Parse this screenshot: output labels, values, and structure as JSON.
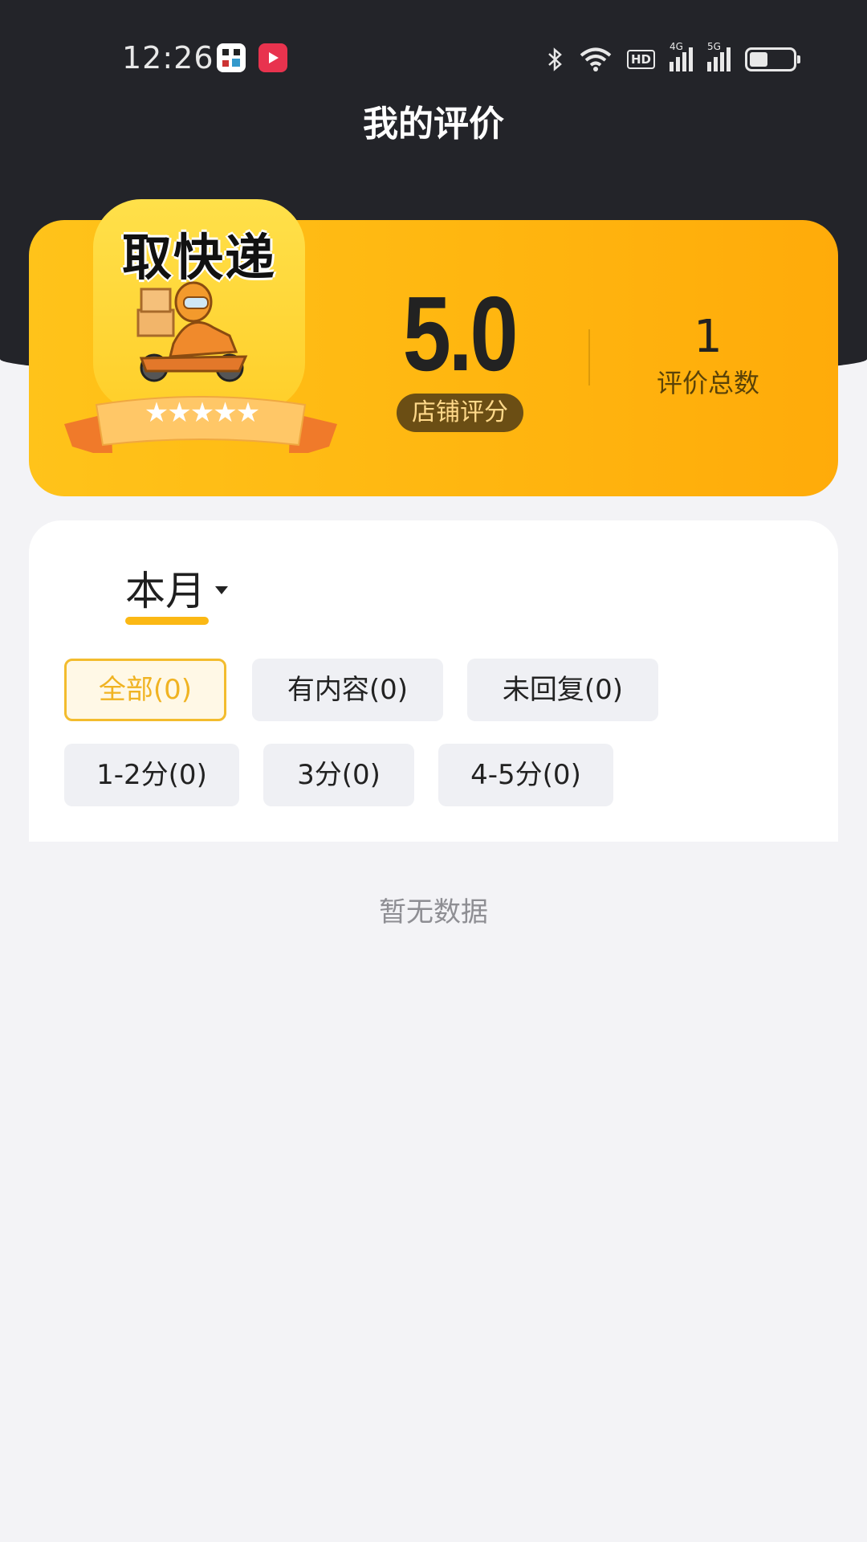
{
  "status_bar": {
    "time": "12:26",
    "signal_1_label": "4G",
    "signal_2_label": "5G",
    "hd_label": "HD"
  },
  "header": {
    "title": "我的评价"
  },
  "score_card": {
    "logo_text": "取快递",
    "stars": "★★★★★",
    "score": "5.0",
    "score_label": "店铺评分",
    "total": "1",
    "total_label": "评价总数"
  },
  "filter": {
    "period": "本月",
    "chips": [
      {
        "label": "全部(0)"
      },
      {
        "label": "有内容(0)"
      },
      {
        "label": "未回复(0)"
      },
      {
        "label": "1-2分(0)"
      },
      {
        "label": "3分(0)"
      },
      {
        "label": "4-5分(0)"
      }
    ]
  },
  "empty_state": "暂无数据",
  "colors": {
    "header_bg": "#232429",
    "accent": "#fbb814",
    "card_gradient_start": "#ffc31a",
    "card_gradient_end": "#ffab0a",
    "page_bg": "#f3f3f6"
  }
}
